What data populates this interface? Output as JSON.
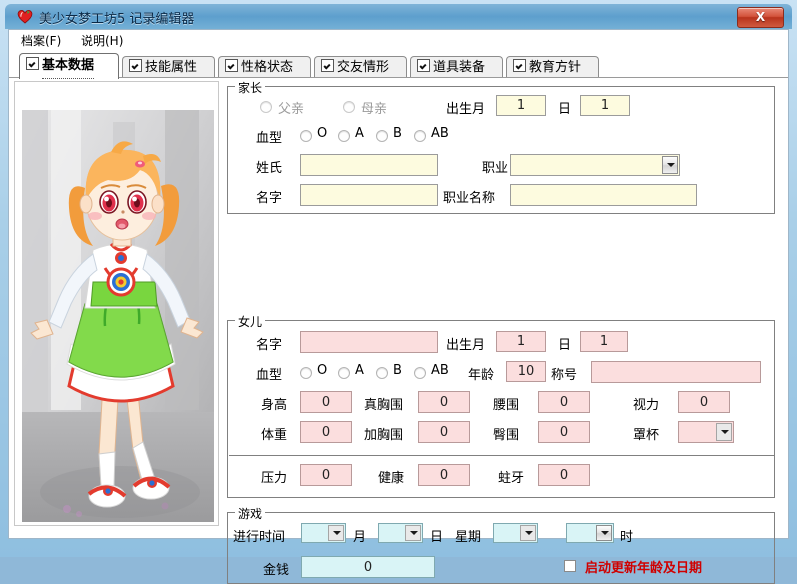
{
  "window": {
    "title": "美少女梦工坊5 记录编辑器",
    "close_label": "X",
    "app_icon": "heart-icon"
  },
  "menu": [
    {
      "label": "档案(F)"
    },
    {
      "label": "说明(H)"
    }
  ],
  "tabs": [
    {
      "label": "基本数据",
      "active": true
    },
    {
      "label": "技能属性",
      "active": false
    },
    {
      "label": "性格状态",
      "active": false
    },
    {
      "label": "交友情形",
      "active": false
    },
    {
      "label": "道具装备",
      "active": false
    },
    {
      "label": "教育方针",
      "active": false
    }
  ],
  "portrait": {
    "alt": "anime-girl-character-illustration"
  },
  "parent": {
    "caption": "家长",
    "radio_father": "父亲",
    "radio_mother": "母亲",
    "birth_month_label": "出生月",
    "birth_month_value": "1",
    "birth_day_label": "日",
    "birth_day_value": "1",
    "blood_label": "血型",
    "blood_options": [
      "O",
      "A",
      "B",
      "AB"
    ],
    "surname_label": "姓氏",
    "surname_value": "",
    "givenname_label": "名字",
    "givenname_value": "",
    "job_label": "职业",
    "job_value": "",
    "jobname_label": "职业名称",
    "jobname_value": ""
  },
  "daughter": {
    "caption": "女儿",
    "name_label": "名字",
    "name_value": "",
    "birth_month_label": "出生月",
    "birth_month_value": "1",
    "birth_day_label": "日",
    "birth_day_value": "1",
    "blood_label": "血型",
    "blood_options": [
      "O",
      "A",
      "B",
      "AB"
    ],
    "age_label": "年龄",
    "age_value": "10",
    "title_label": "称号",
    "title_value": "",
    "stats": [
      {
        "label": "身高",
        "value": "0"
      },
      {
        "label": "真胸围",
        "value": "0"
      },
      {
        "label": "腰围",
        "value": "0"
      },
      {
        "label": "视力",
        "value": "0"
      },
      {
        "label": "体重",
        "value": "0"
      },
      {
        "label": "加胸围",
        "value": "0"
      },
      {
        "label": "臀围",
        "value": "0"
      }
    ],
    "cup_label": "罩杯",
    "cup_value": "",
    "bottom_stats": [
      {
        "label": "压力",
        "value": "0"
      },
      {
        "label": "健康",
        "value": "0"
      },
      {
        "label": "蛀牙",
        "value": "0"
      }
    ]
  },
  "game": {
    "caption": "游戏",
    "time_label": "进行时间",
    "month_value": "",
    "month_unit": "月",
    "day_value": "",
    "day_unit": "日",
    "weekday_label": "星期",
    "weekday_value": "",
    "hour_value": "",
    "hour_unit": "时",
    "money_label": "金钱",
    "money_value": "0",
    "update_checkbox_label": "启动更新年龄及日期"
  },
  "colors": {
    "parent_field_bg": "#fdfbdf",
    "daughter_field_bg": "#fbdede",
    "game_field_bg": "#d9f4f6",
    "accent_red": "#d00000",
    "titlebar": "#5d9fcd"
  }
}
